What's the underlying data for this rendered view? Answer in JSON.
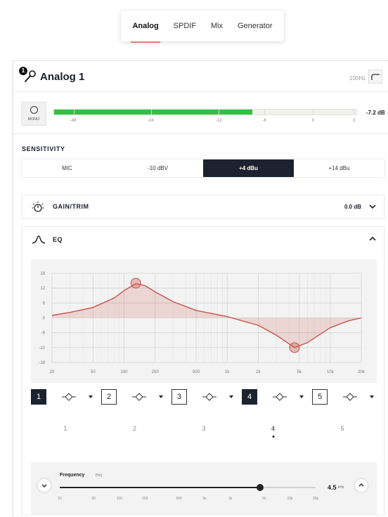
{
  "tabs": [
    {
      "label": "Analog",
      "active": true
    },
    {
      "label": "SPDIF",
      "active": false
    },
    {
      "label": "Mix",
      "active": false
    },
    {
      "label": "Generator",
      "active": false
    }
  ],
  "channel": {
    "badge": "1",
    "title": "Analog 1",
    "hpf_label": "100Hz",
    "mono_label": "MONO",
    "meter": {
      "level_db": -7.2,
      "readout": "-7.2 dB",
      "fill_fraction": 0.655,
      "scale": [
        "-48",
        "-24",
        "-12",
        "-6",
        "0",
        "3"
      ],
      "fill_color": "#33c040"
    }
  },
  "sensitivity": {
    "title": "SENSITIVITY",
    "options": [
      "MIC",
      "-10 dBV",
      "+4 dBu",
      "+14 dBu"
    ],
    "selected": "+4 dBu"
  },
  "gain": {
    "title": "GAIN/TRIM",
    "value": "0.0 dB"
  },
  "eq": {
    "title": "EQ",
    "bands": [
      {
        "number": "1",
        "active": true,
        "label": "1"
      },
      {
        "number": "2",
        "active": false,
        "label": "2"
      },
      {
        "number": "3",
        "active": false,
        "label": "3"
      },
      {
        "number": "4",
        "active": true,
        "label": "4"
      },
      {
        "number": "5",
        "active": false,
        "label": "5"
      }
    ],
    "selected_band": "4",
    "frequency": {
      "label": "Frequency",
      "unit": "[Hz]",
      "value": "4.5",
      "value_unit": "kHz",
      "ticks": [
        "20",
        "50",
        "100",
        "200",
        "500",
        "1k",
        "2k",
        "5k",
        "10k",
        "20k"
      ]
    },
    "accent_color": "#c8534a"
  },
  "chart_data": {
    "type": "line",
    "title": "",
    "xlabel": "",
    "ylabel": "",
    "x_scale": "log",
    "xlim": [
      20,
      20000
    ],
    "ylim": [
      -18,
      18
    ],
    "x_ticks": [
      "20",
      "50",
      "100",
      "200",
      "500",
      "1k",
      "2k",
      "5k",
      "10k",
      "20k"
    ],
    "y_ticks": [
      "18",
      "12",
      "6",
      "0",
      "-6",
      "-12",
      "-18"
    ],
    "grid": true,
    "series": [
      {
        "points": [
          {
            "x": 20,
            "y": 1.0
          },
          {
            "x": 30,
            "y": 2.2
          },
          {
            "x": 50,
            "y": 4.2
          },
          {
            "x": 80,
            "y": 8.0
          },
          {
            "x": 100,
            "y": 11.0
          },
          {
            "x": 130,
            "y": 13.8
          },
          {
            "x": 160,
            "y": 13.0
          },
          {
            "x": 200,
            "y": 10.5
          },
          {
            "x": 300,
            "y": 6.5
          },
          {
            "x": 500,
            "y": 3.0
          },
          {
            "x": 1000,
            "y": 0.5
          },
          {
            "x": 2000,
            "y": -3.0
          },
          {
            "x": 3000,
            "y": -7.0
          },
          {
            "x": 4500,
            "y": -12.0
          },
          {
            "x": 6000,
            "y": -10.0
          },
          {
            "x": 10000,
            "y": -4.0
          },
          {
            "x": 15000,
            "y": -1.2
          },
          {
            "x": 20000,
            "y": 0.0
          }
        ]
      }
    ],
    "handles": [
      {
        "x": 130,
        "y": 14.0
      },
      {
        "x": 4500,
        "y": -12.0
      }
    ]
  }
}
